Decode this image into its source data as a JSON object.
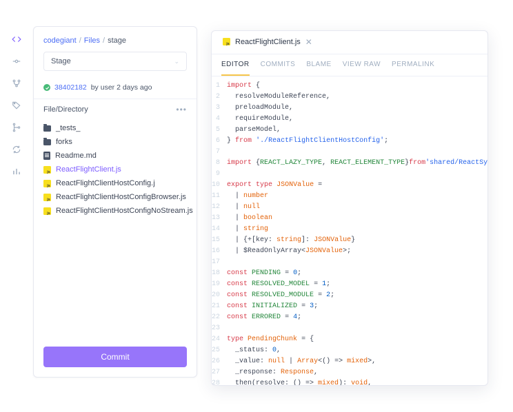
{
  "colors": {
    "accent": "#7c5cff",
    "link": "#4c6ef5",
    "success": "#48bb78",
    "jsIcon": "#f7df1e",
    "tabIndicator": "#f6c549"
  },
  "rail": {
    "items": [
      {
        "name": "code",
        "active": true
      },
      {
        "name": "commits",
        "active": false
      },
      {
        "name": "branches",
        "active": false
      },
      {
        "name": "tags",
        "active": false
      },
      {
        "name": "merge",
        "active": false
      },
      {
        "name": "sync",
        "active": false
      },
      {
        "name": "stats",
        "active": false
      }
    ]
  },
  "breadcrumb": {
    "parts": [
      {
        "label": "codegiant",
        "link": true
      },
      {
        "label": "Files",
        "link": true
      },
      {
        "label": "stage",
        "link": false
      }
    ],
    "sep": "/"
  },
  "branchSelect": {
    "value": "Stage"
  },
  "commitLine": {
    "hash": "38402182",
    "by": "by user 2 days ago"
  },
  "fileSection": {
    "title": "File/Directory"
  },
  "tree": [
    {
      "kind": "folder",
      "name": "_tests_"
    },
    {
      "kind": "folder",
      "name": "forks"
    },
    {
      "kind": "doc",
      "name": "Readme.md"
    },
    {
      "kind": "js",
      "name": "ReactFlightClient.js",
      "active": true
    },
    {
      "kind": "js",
      "name": "ReactFlightClientHostConfig.j"
    },
    {
      "kind": "js",
      "name": "ReactFlightClientHostConfigBrowser.js"
    },
    {
      "kind": "js",
      "name": "ReactFlightClientHostConfigNoStream.js"
    }
  ],
  "commitButton": {
    "label": "Commit"
  },
  "editor": {
    "fileTab": {
      "name": "ReactFlightClient.js"
    },
    "viewTabs": [
      {
        "label": "EDITOR",
        "active": true
      },
      {
        "label": "COMMITS"
      },
      {
        "label": "BLAME"
      },
      {
        "label": "VIEW RAW"
      },
      {
        "label": "PERMALINK"
      }
    ],
    "lines": [
      "import {",
      "  resolveModuleReference,",
      "  preloadModule,",
      "  requireModule,",
      "  parseModel,",
      "} from './ReactFlightClientHostConfig';",
      "",
      "import {REACT_LAZY_TYPE, REACT_ELEMENT_TYPE}from'shared/ReactSymbols';",
      "",
      "export type JSONValue =",
      "  | number",
      "  | null",
      "  | boolean",
      "  | string",
      "  | {+[key: string]: JSONValue}",
      "  | $ReadOnlyArray<JSONValue>;",
      "",
      "const PENDING = 0;",
      "const RESOLVED_MODEL = 1;",
      "const RESOLVED_MODULE = 2;",
      "const INITIALIZED = 3;",
      "const ERRORED = 4;",
      "",
      "type PendingChunk = {",
      "  _status: 0,",
      "  _value: null | Array<() => mixed>,",
      "  _response: Response,",
      "  then(resolve: () => mixed): void,",
      "};",
      ""
    ]
  }
}
